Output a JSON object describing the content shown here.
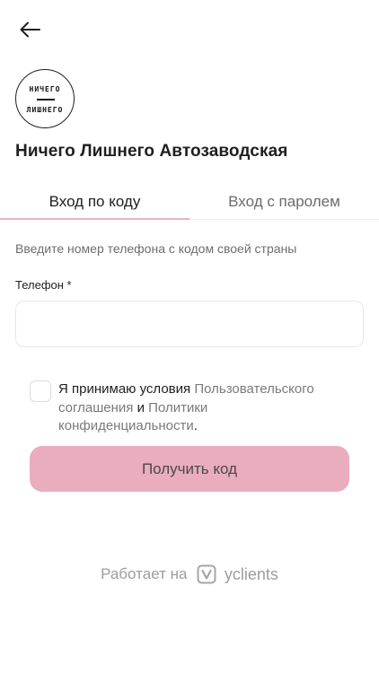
{
  "header": {
    "back_icon": "arrow-left-icon"
  },
  "company": {
    "logo_line1": "НИЧЕГО",
    "logo_line2": "ЛИШНЕГО",
    "name": "Ничего Лишнего Автозаводская"
  },
  "tabs": [
    {
      "label": "Вход по коду",
      "active": true
    },
    {
      "label": "Вход с паролем",
      "active": false
    }
  ],
  "form": {
    "hint": "Введите номер телефона с кодом своей страны",
    "phone_label": "Телефон *",
    "phone_value": "",
    "agree_prefix": "Я принимаю условия",
    "agree_link1": "Пользовательского соглашения",
    "agree_middle": "и",
    "agree_link2": "Политики конфиденциальности",
    "agree_suffix": ".",
    "agree_checked": false,
    "submit_label": "Получить код"
  },
  "footer": {
    "prefix": "Работает на",
    "brand": "yclients",
    "brand_icon": "yclients-logo-icon"
  },
  "colors": {
    "accent": "#eaadbd",
    "tab_indicator": "#eab1c0",
    "link": "#7a7a7a",
    "muted": "#6e6e6e"
  }
}
